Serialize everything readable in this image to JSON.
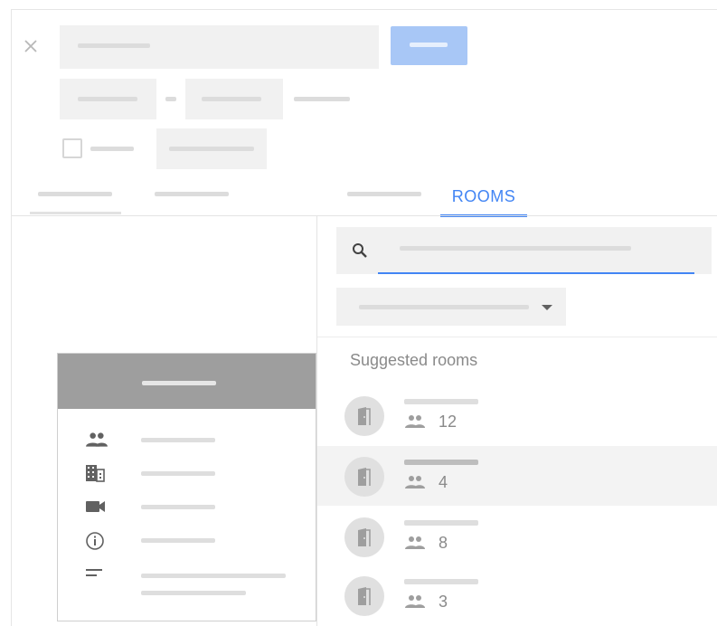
{
  "rooms_tab": {
    "label": "ROOMS"
  },
  "rooms_panel": {
    "section_title": "Suggested rooms",
    "rooms": [
      {
        "capacity": "12",
        "selected": false
      },
      {
        "capacity": "4",
        "selected": true
      },
      {
        "capacity": "8",
        "selected": false
      },
      {
        "capacity": "3",
        "selected": false
      }
    ]
  },
  "colors": {
    "accent": "#4285f4",
    "placeholder_block": "#f1f1f1",
    "card_header": "#9e9e9e"
  },
  "icons": {
    "close": "close-icon",
    "search": "search-icon",
    "dropdown": "dropdown-arrow-icon",
    "room": "door-icon",
    "capacity": "people-icon",
    "building": "building-icon",
    "video": "video-camera-icon",
    "info": "info-icon",
    "description": "description-icon"
  }
}
